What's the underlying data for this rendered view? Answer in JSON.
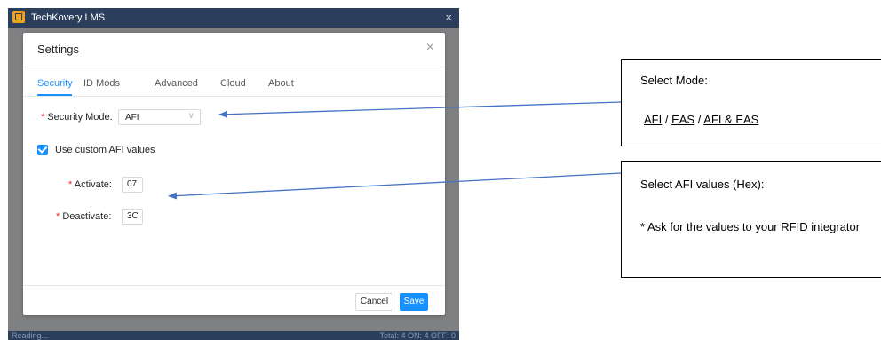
{
  "window": {
    "title": "TechKovery LMS",
    "close_glyph": "×",
    "status_left": "Reading...",
    "status_right": "Total: 4  ON: 4  OFF: 0"
  },
  "dialog": {
    "title": "Settings",
    "close_glyph": "×",
    "tabs": [
      {
        "label": "Security",
        "active": true
      },
      {
        "label": "ID Mods",
        "active": false
      },
      {
        "label": "Advanced",
        "active": false
      },
      {
        "label": "Cloud",
        "active": false
      },
      {
        "label": "About",
        "active": false
      }
    ],
    "security_mode": {
      "required_mark": "*",
      "label": "Security Mode:",
      "value": "AFI",
      "chevron": "∨"
    },
    "custom_afi": {
      "checked": true,
      "label": "Use custom AFI values"
    },
    "activate": {
      "required_mark": "*",
      "label": "Activate:",
      "value": "07"
    },
    "deactivate": {
      "required_mark": "*",
      "label": "Deactivate:",
      "value": "3C"
    },
    "buttons": {
      "cancel": "Cancel",
      "save": "Save"
    }
  },
  "callouts": {
    "mode": {
      "title": "Select Mode:",
      "options": [
        "AFI",
        "EAS",
        "AFI & EAS"
      ],
      "separator": " / "
    },
    "afi": {
      "title": "Select AFI values (Hex):",
      "note": "* Ask for the values to your RFID integrator"
    }
  },
  "colors": {
    "titlebar": "#2b3f5d",
    "accent": "#1890ff",
    "arrow": "#4472c4",
    "required": "#f5222d"
  },
  "icons": {
    "app_logo": "techkovery-logo-icon",
    "close": "close-icon",
    "check": "check-icon",
    "chevron": "chevron-down-icon"
  }
}
